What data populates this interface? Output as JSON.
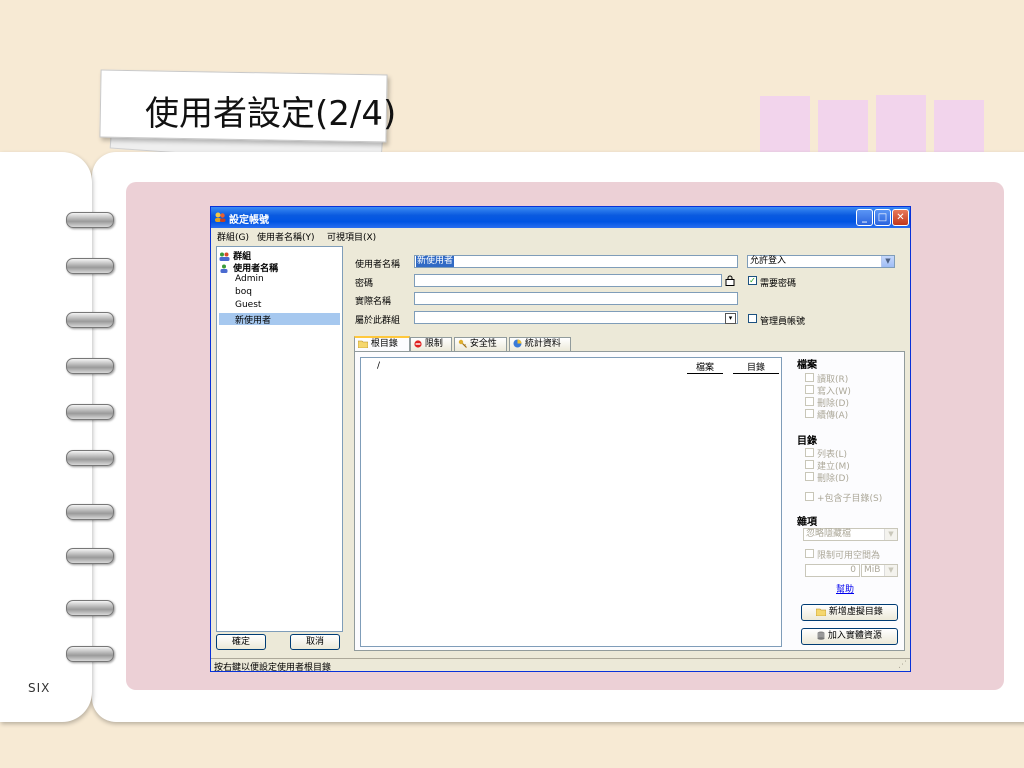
{
  "slide": {
    "title": "使用者設定(2/4)",
    "footer": "SIX"
  },
  "window": {
    "title": "設定帳號",
    "menu": [
      "群組(G)",
      "使用者名稱(Y)",
      "可視項目(X)"
    ],
    "tree": {
      "root_groups": "群組",
      "root_users": "使用者名稱",
      "users": [
        "Admin",
        "boq",
        "Guest",
        "新使用者"
      ],
      "selected_user": "新使用者"
    },
    "buttons": {
      "ok": "確定",
      "cancel": "取消"
    },
    "form": {
      "username_label": "使用者名稱",
      "username_value": "新使用者",
      "password_label": "密碼",
      "realname_label": "實際名稱",
      "group_label": "屬於此群組",
      "login_option": "允許登入",
      "require_password": "需要密碼",
      "require_password_checked": true,
      "admin_account": "管理員帳號",
      "admin_account_checked": false
    },
    "tabs": [
      "根目錄",
      "限制",
      "安全性",
      "統計資料"
    ],
    "active_tab": "根目錄",
    "list": {
      "root_entry": "/",
      "col_files": "檔案",
      "col_dirs": "目錄"
    },
    "perms": {
      "files_heading": "檔案",
      "files": [
        "讀取(R)",
        "寫入(W)",
        "刪除(D)",
        "續傳(A)"
      ],
      "dirs_heading": "目錄",
      "dirs": [
        "列表(L)",
        "建立(M)",
        "刪除(D)"
      ],
      "subdirs": "+包含子目錄(S)",
      "misc_heading": "雜項",
      "hidden_option": "忽略隱藏檔",
      "quota_label": "限制可用空間為",
      "quota_value": "0",
      "quota_unit": "MiB",
      "help_link": "幫助",
      "add_virtual": "新增虛擬目錄",
      "add_physical": "加入實體資源"
    },
    "status": "按右鍵以便設定使用者根目錄"
  }
}
